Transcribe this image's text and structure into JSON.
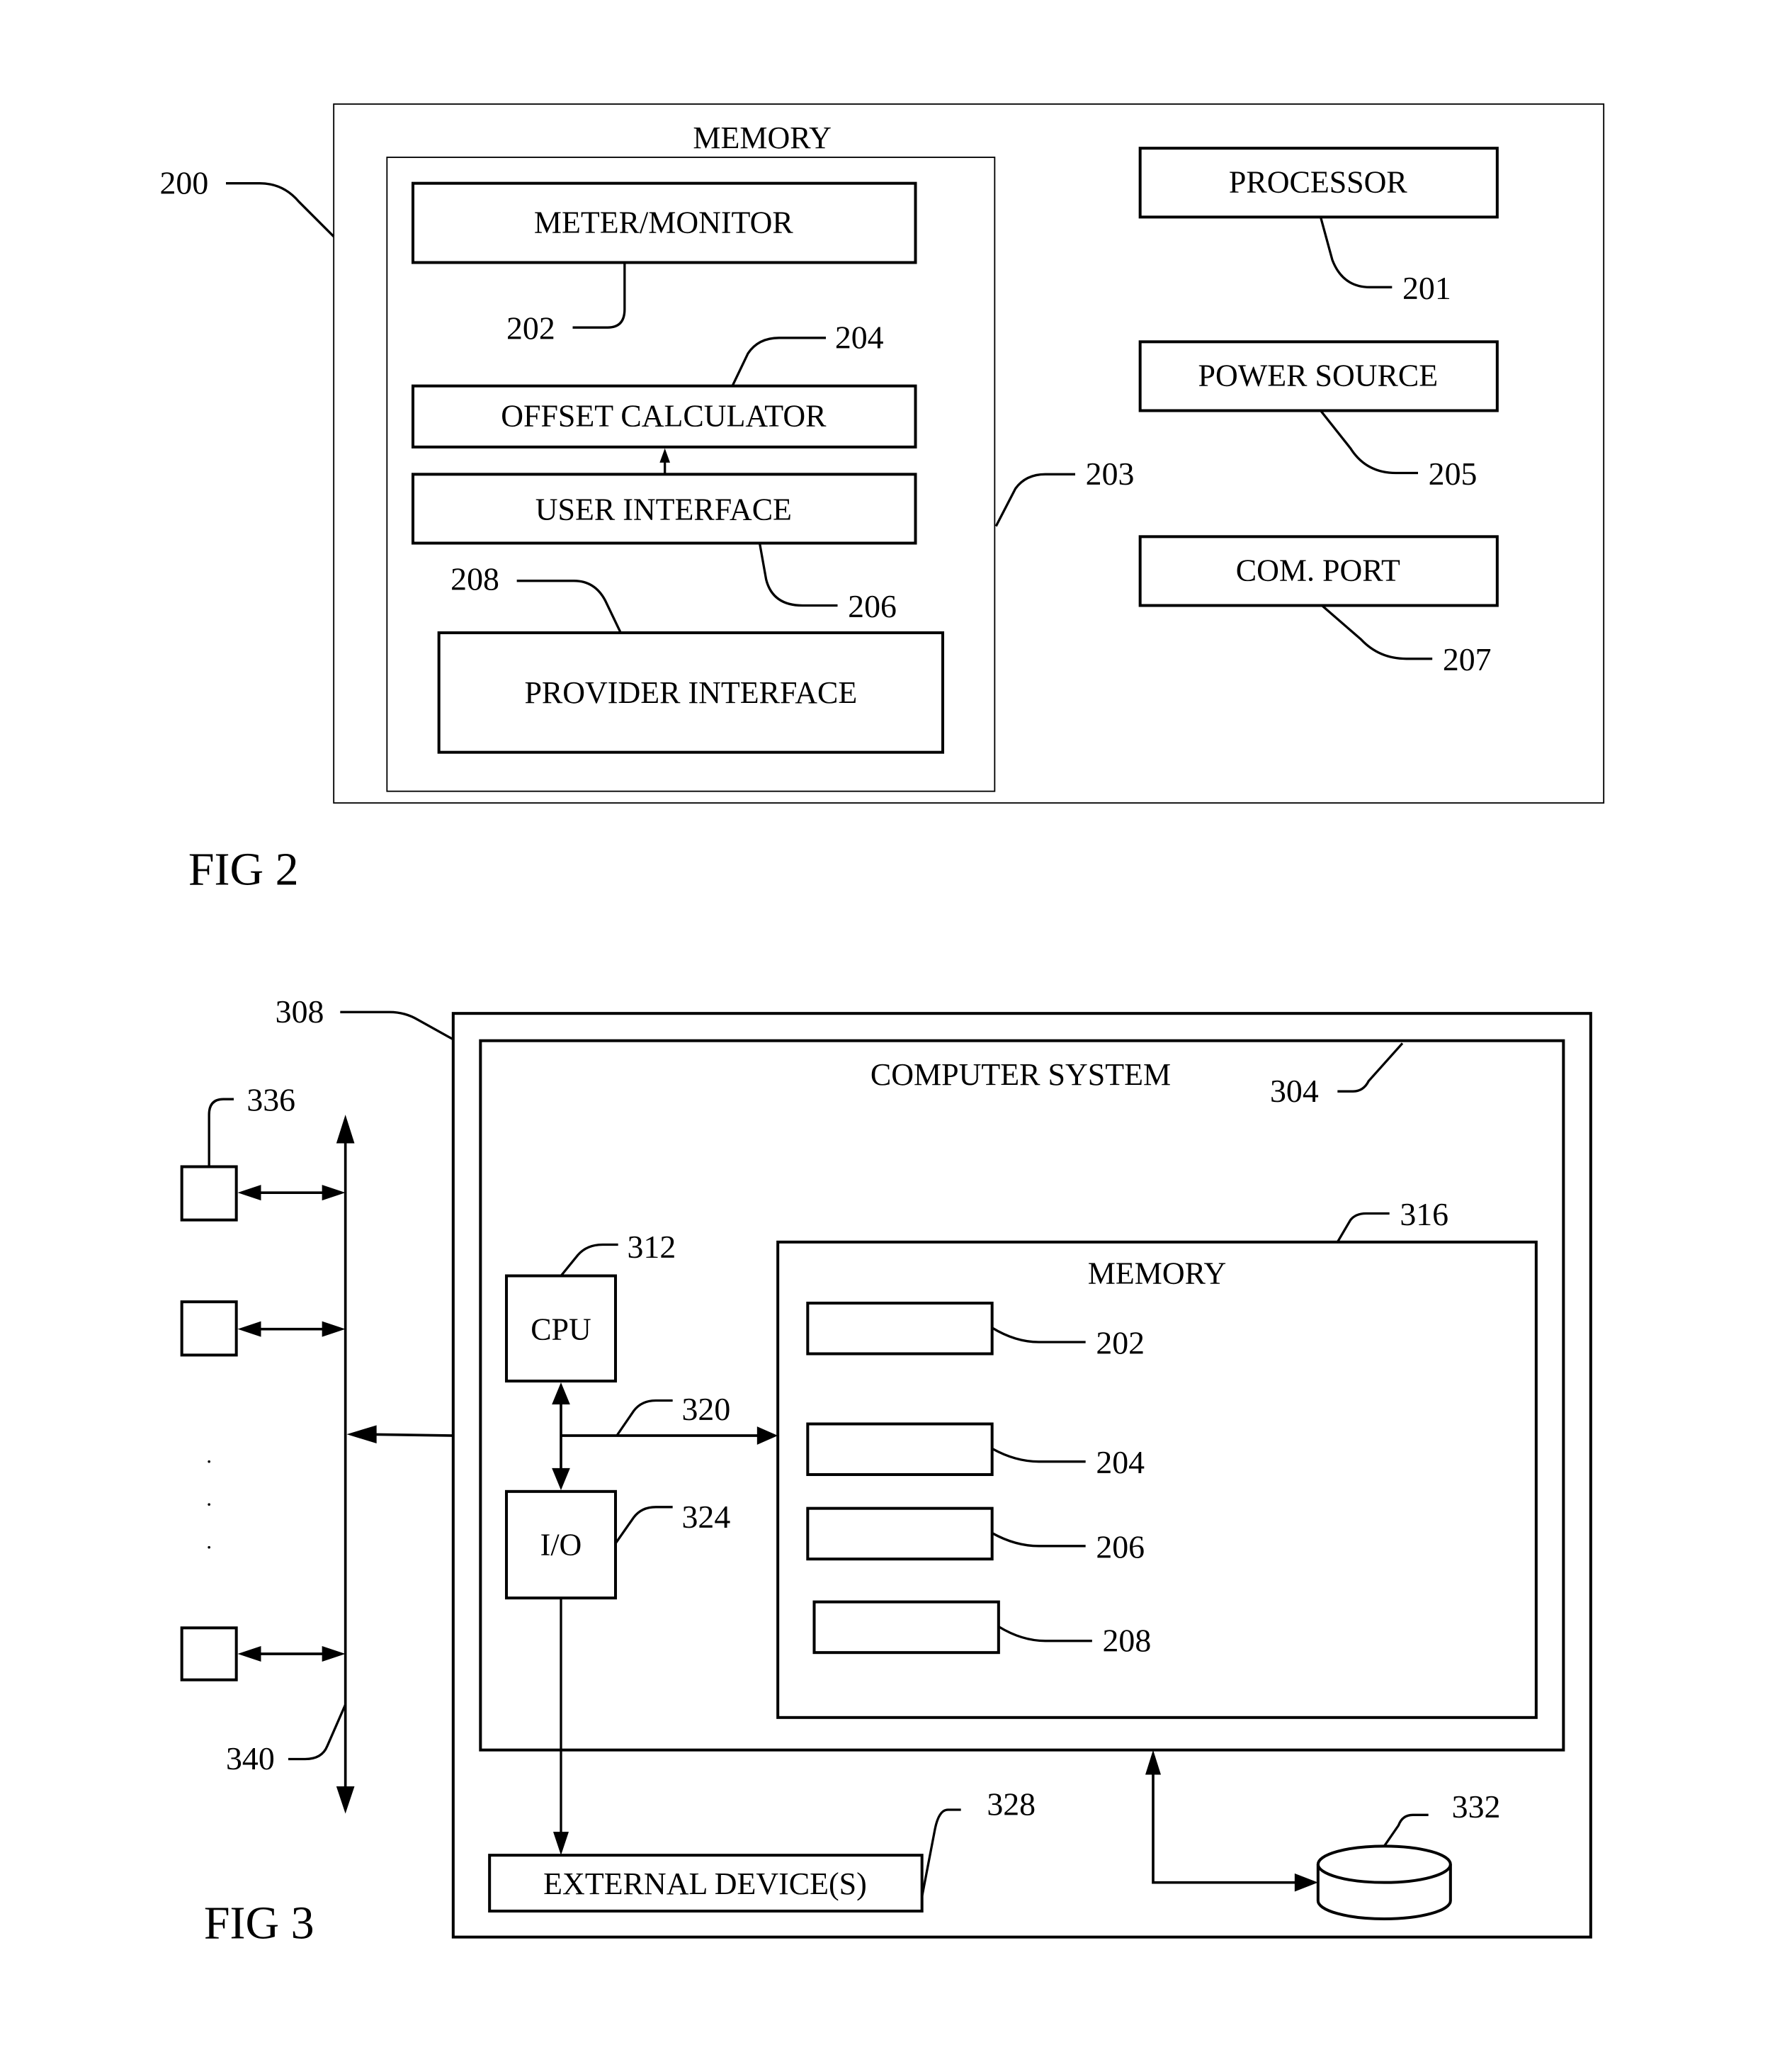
{
  "fig2": {
    "caption": "FIG 2",
    "device_ref": "200",
    "memory": {
      "title": "MEMORY",
      "ref": "203"
    },
    "blocks": {
      "meter_monitor": {
        "label": "METER/MONITOR",
        "ref": "202"
      },
      "offset_calculator": {
        "label": "OFFSET CALCULATOR",
        "ref": "204"
      },
      "user_interface": {
        "label": "USER INTERFACE",
        "ref": "206"
      },
      "provider_interface": {
        "label": "PROVIDER INTERFACE",
        "ref": "208"
      },
      "processor": {
        "label": "PROCESSOR",
        "ref": "201"
      },
      "power_source": {
        "label": "POWER SOURCE",
        "ref": "205"
      },
      "com_port": {
        "label": "COM. PORT",
        "ref": "207"
      }
    }
  },
  "fig3": {
    "caption": "FIG 3",
    "outer_ref": "308",
    "computer_system": {
      "title": "COMPUTER SYSTEM",
      "ref": "304"
    },
    "cpu": {
      "label": "CPU",
      "ref": "312"
    },
    "io": {
      "label": "I/O",
      "ref": "324"
    },
    "bus_ref": "320",
    "memory": {
      "title": "MEMORY",
      "ref": "316",
      "modules": [
        {
          "ref": "202"
        },
        {
          "ref": "204"
        },
        {
          "ref": "206"
        },
        {
          "ref": "208"
        }
      ]
    },
    "external_devices": {
      "label": "EXTERNAL DEVICE(S)",
      "ref": "328"
    },
    "storage_ref": "332",
    "peripheral_ref": "336",
    "network_bus_ref": "340",
    "ellipsis": "· · ·"
  }
}
